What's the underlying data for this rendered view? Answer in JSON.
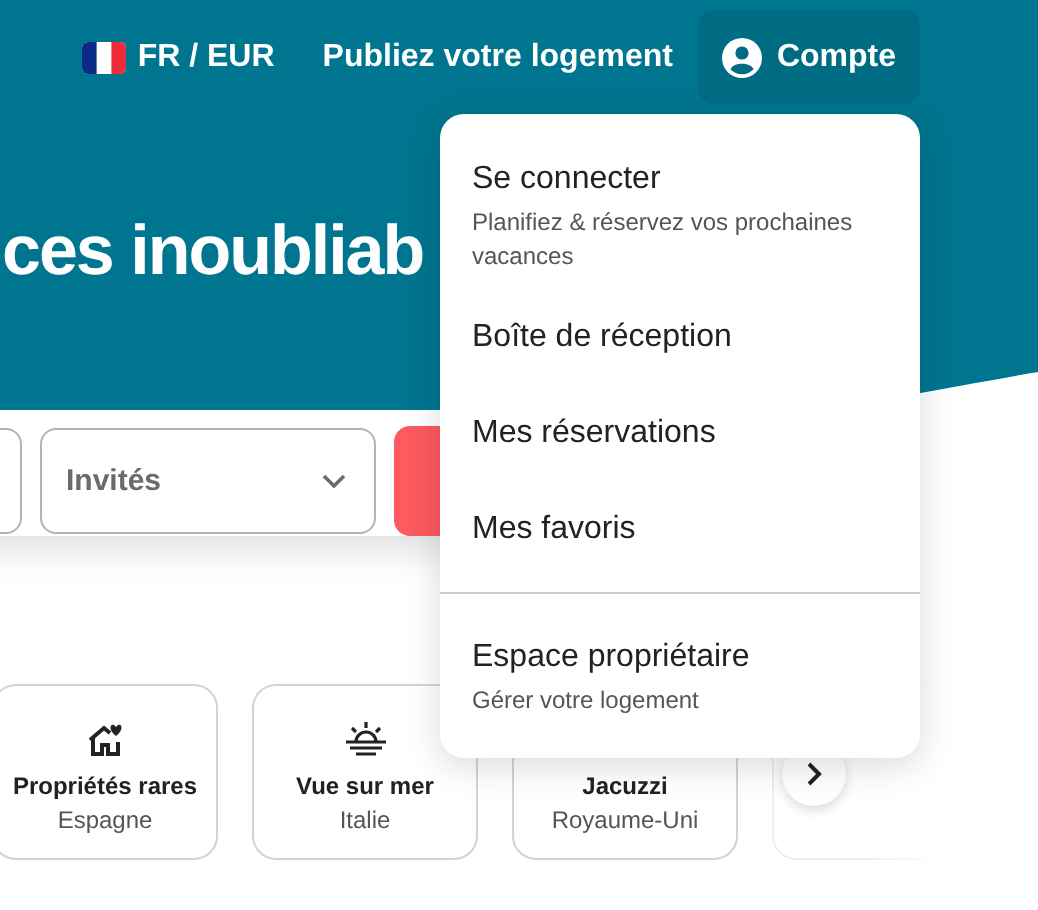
{
  "nav": {
    "locale": "FR / EUR",
    "host_link": "Publiez votre logement",
    "account": "Compte"
  },
  "hero": {
    "title": "ces inoubliab"
  },
  "search": {
    "guests_placeholder": "Invités"
  },
  "categories": [
    {
      "title": "Propriétés rares",
      "place": "Espagne"
    },
    {
      "title": "Vue sur mer",
      "place": "Italie"
    },
    {
      "title": "Jacuzzi",
      "place": "Royaume-Uni"
    }
  ],
  "menu": {
    "groups": [
      [
        {
          "label": "Se connecter",
          "description": "Planifiez & réservez vos prochaines vacances"
        },
        {
          "label": "Boîte de réception"
        },
        {
          "label": "Mes réservations"
        },
        {
          "label": "Mes favoris"
        }
      ],
      [
        {
          "label": "Espace propriétaire",
          "description": "Gérer votre logement"
        }
      ]
    ]
  }
}
